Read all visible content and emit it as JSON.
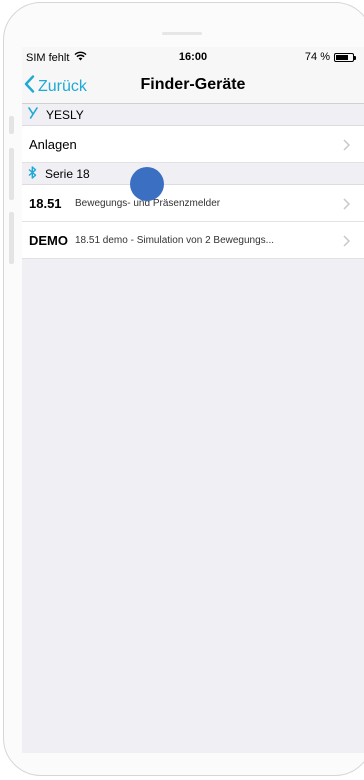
{
  "status_bar": {
    "carrier": "SIM fehlt",
    "time": "16:00",
    "battery": "74 %",
    "battery_level": 0.74
  },
  "nav": {
    "back_label": "Zurück",
    "title": "Finder-Geräte"
  },
  "sections": [
    {
      "header": "YESLY",
      "icon": "yesly-logo-icon",
      "rows": [
        {
          "title": "Anlagen"
        }
      ]
    },
    {
      "header": "Serie 18",
      "icon": "bluetooth-icon",
      "rows": [
        {
          "code": "18.51",
          "desc": "Bewegungs- und Präsenzmelder"
        },
        {
          "code": "DEMO",
          "desc": "18.51 demo - Simulation von 2 Bewegungs..."
        }
      ]
    }
  ],
  "colors": {
    "accent": "#1fa9d6",
    "background": "#efeff4",
    "touch_indicator": "#3b6fc2"
  }
}
